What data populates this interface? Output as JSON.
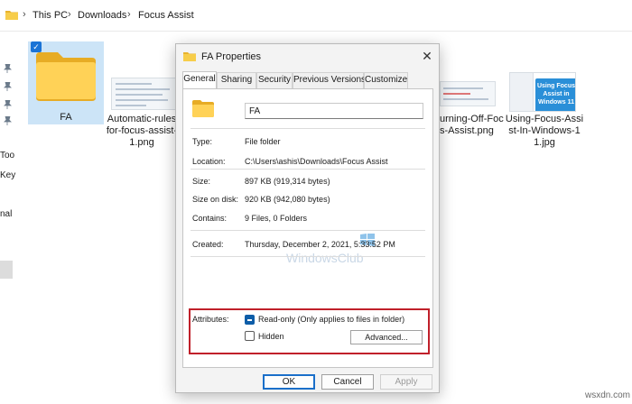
{
  "explorer": {
    "breadcrumb": [
      "This PC",
      "Downloads",
      "Focus Assist"
    ],
    "nav_fragments": [
      "Too",
      "Key",
      "nal"
    ],
    "files": [
      {
        "name_lines": [
          "FA"
        ],
        "selected": true,
        "kind": "folder"
      },
      {
        "name_lines": [
          "Automatic-rules",
          "for-focus-assist-",
          "1.png"
        ],
        "kind": "image"
      },
      {
        "name_lines": [
          "urning-Off-Foc",
          "s-Assist.png"
        ],
        "kind": "image"
      },
      {
        "name_lines": [
          "Using-Focus-Assi",
          "st-In-Windows-1",
          "1.jpg"
        ],
        "kind": "image"
      }
    ],
    "thumb_text": "Using Focus Assist in Windows 11"
  },
  "dialog": {
    "title": "FA Properties",
    "tabs": [
      "General",
      "Sharing",
      "Security",
      "Previous Versions",
      "Customize"
    ],
    "active_tab": "General",
    "name_value": "FA",
    "props": [
      {
        "label": "Type:",
        "value": "File folder"
      },
      {
        "label": "Location:",
        "value": "C:\\Users\\ashis\\Downloads\\Focus Assist"
      },
      {
        "label": "Size:",
        "value": "897 KB (919,314 bytes)"
      },
      {
        "label": "Size on disk:",
        "value": "920 KB (942,080 bytes)"
      },
      {
        "label": "Contains:",
        "value": "9 Files, 0 Folders"
      }
    ],
    "created": {
      "label": "Created:",
      "value": "Thursday, December 2, 2021, 5:33:52 PM"
    },
    "attributes": {
      "label": "Attributes:",
      "readonly": {
        "label": "Read-only (Only applies to files in folder)",
        "state": "indeterminate"
      },
      "hidden": {
        "label": "Hidden",
        "state": "unchecked"
      },
      "advanced_label": "Advanced..."
    },
    "buttons": {
      "ok": "OK",
      "cancel": "Cancel",
      "apply": "Apply"
    },
    "watermark": "WindowsClub"
  },
  "credit": "wsxdn.com",
  "colors": {
    "highlight_border": "#c0202a",
    "selection": "#cce4f7",
    "accent": "#0e5da8"
  }
}
